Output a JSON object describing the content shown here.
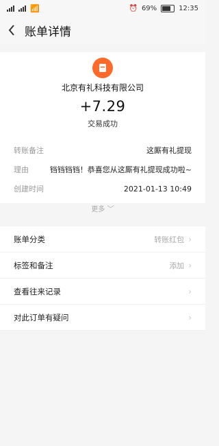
{
  "statusbar": {
    "signal_left": "ᯤ",
    "battery_percent": "69%",
    "time": "12:35"
  },
  "header": {
    "back_icon": "<",
    "title": "账单详情"
  },
  "top": {
    "merchant": "北京有礼科技有限公司",
    "amount": "+7.29",
    "status": "交易成功"
  },
  "details": [
    {
      "label": "转账备注",
      "value": "这厮有礼提现"
    },
    {
      "label": "理由",
      "value": "铛铛铛铛！恭喜您从这厮有礼提现成功啦~"
    },
    {
      "label": "创建时间",
      "value": "2021-01-13 10:49"
    }
  ],
  "more": {
    "label": "更多 ﹀"
  },
  "list": [
    {
      "label": "账单分类",
      "value": "转账红包"
    },
    {
      "label": "标签和备注",
      "value": "添加"
    },
    {
      "label": "查看往来记录",
      "value": ""
    },
    {
      "label": "对此订单有疑问",
      "value": ""
    }
  ],
  "colors": {
    "accent": "#ff6a2b",
    "background": "#f5f5f5"
  }
}
